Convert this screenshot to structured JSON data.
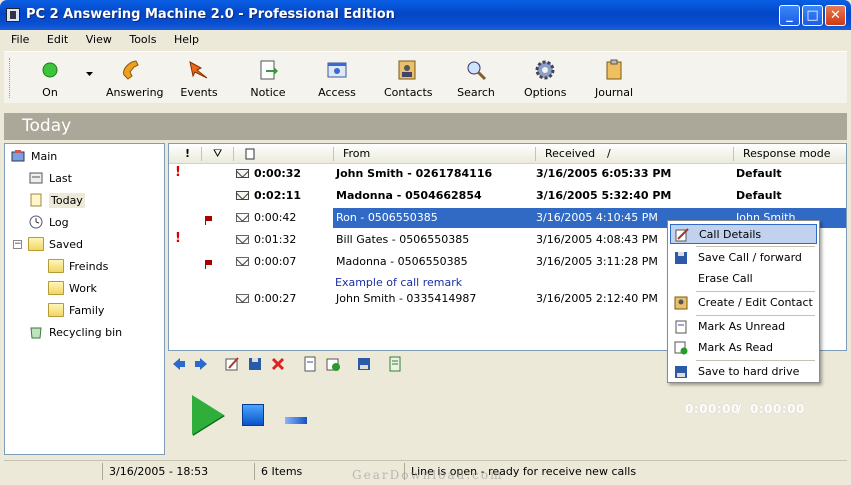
{
  "window": {
    "title": "PC 2 Answering Machine 2.0 - Professional Edition",
    "min": "_",
    "max": "□",
    "close": "✕"
  },
  "menu": [
    "File",
    "Edit",
    "View",
    "Tools",
    "Help"
  ],
  "toolbar": [
    {
      "label": "On",
      "icon": "green-dot-icon"
    },
    {
      "label": "Answering",
      "icon": "phone-icon"
    },
    {
      "label": "Events",
      "icon": "events-icon"
    },
    {
      "label": "Notice",
      "icon": "notice-icon"
    },
    {
      "label": "Access",
      "icon": "access-icon"
    },
    {
      "label": "Contacts",
      "icon": "contacts-icon"
    },
    {
      "label": "Search",
      "icon": "search-icon"
    },
    {
      "label": "Options",
      "icon": "gear-icon"
    },
    {
      "label": "Journal",
      "icon": "journal-icon"
    }
  ],
  "banner": "Today",
  "tree": {
    "main": "Main",
    "last": "Last",
    "today": "Today",
    "log": "Log",
    "saved": "Saved",
    "freinds": "Freinds",
    "work": "Work",
    "family": "Family",
    "recycle": "Recycling bin"
  },
  "grid": {
    "headers": {
      "priority": "!",
      "flag": "⛛",
      "from": "From",
      "received": "Received",
      "sort": "/",
      "response": "Response mode"
    },
    "rows": [
      {
        "duration": "0:00:32",
        "from": "John Smith - 0261784116",
        "received": "3/16/2005 6:05:33 PM",
        "response": "Default"
      },
      {
        "duration": "0:02:11",
        "from": "Madonna - 0504662854",
        "received": "3/16/2005 5:32:40 PM",
        "response": "Default"
      },
      {
        "duration": "0:00:42",
        "from": "Ron - 0506550385",
        "received": "3/16/2005 4:10:45 PM",
        "response": "John Smith"
      },
      {
        "duration": "0:01:32",
        "from": "Bill Gates - 0506550385",
        "received": "3/16/2005 4:08:43 PM",
        "response": ""
      },
      {
        "duration": "0:00:07",
        "from": "Madonna - 0506550385",
        "received": "3/16/2005 3:11:28 PM",
        "response": ""
      },
      {
        "duration": "0:00:27",
        "from": "John Smith - 0335414987",
        "received": "3/16/2005 2:12:40 PM",
        "response": ""
      }
    ],
    "remark": "Example of call remark"
  },
  "context_menu": [
    "Call Details",
    "Save Call / forward",
    "Erase Call",
    "Create / Edit Contact",
    "Mark As Unread",
    "Mark As Read",
    "Save to hard drive"
  ],
  "player": {
    "elapsed": "0:00:00",
    "sep": "/",
    "total": "0:00:00"
  },
  "status": {
    "datetime": "3/16/2005 - 18:53",
    "items": "6 Items",
    "line": "Line is open - ready for receive new calls"
  },
  "watermark": "GearDownload.com"
}
